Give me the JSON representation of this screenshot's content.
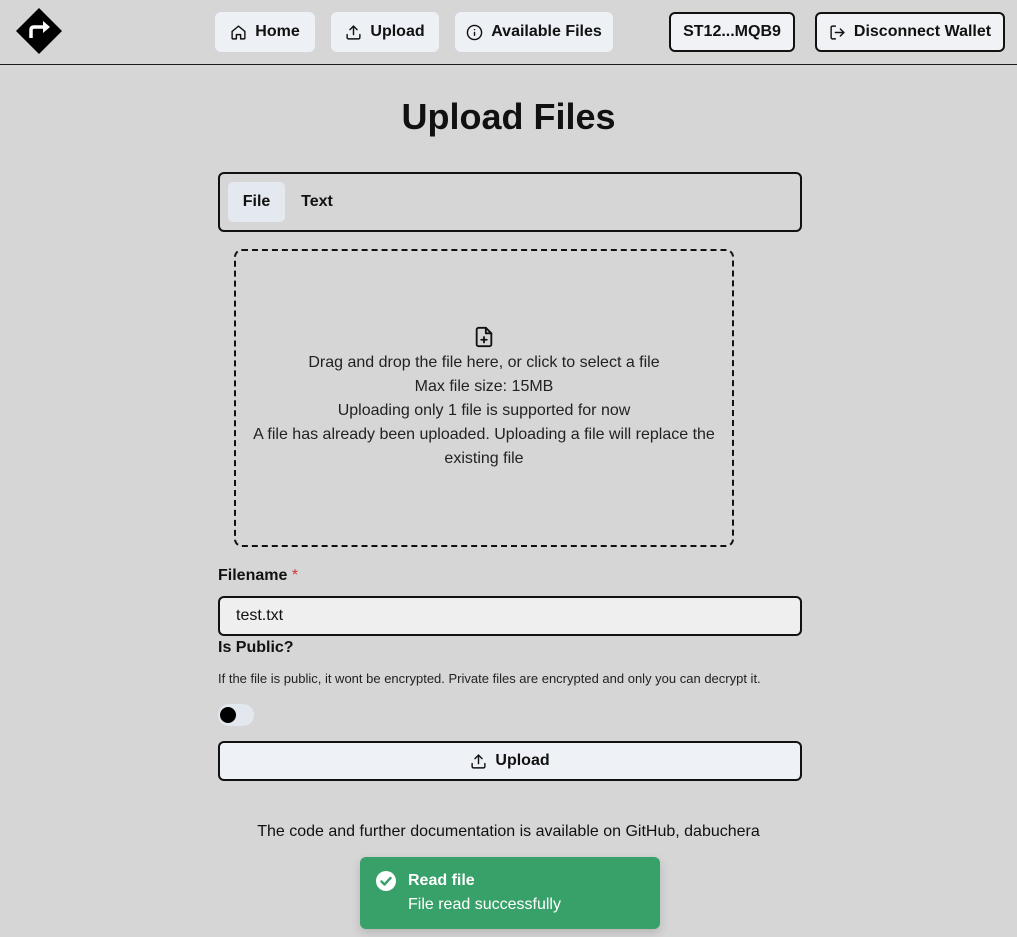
{
  "header": {
    "nav": {
      "home_label": "Home",
      "upload_label": "Upload",
      "available_files_label": "Available Files"
    },
    "wallet_address": "ST12...MQB9",
    "disconnect_label": "Disconnect Wallet"
  },
  "page_title": "Upload Files",
  "tabs": [
    {
      "label": "File",
      "active": true
    },
    {
      "label": "Text",
      "active": false
    }
  ],
  "dropzone": {
    "icon": "file-plus-icon",
    "line1": "Drag and drop the file here, or click to select a file",
    "line2": "Max file size: 15MB",
    "line3": "Uploading only 1 file is supported for now",
    "line4": "A file has already been uploaded. Uploading a file will replace the existing file"
  },
  "form": {
    "filename_label": "Filename",
    "required_mark": "*",
    "filename_value": "test.txt",
    "is_public_label": "Is Public?",
    "is_public_help": "If the file is public, it wont be encrypted. Private files are encrypted and only you can decrypt it.",
    "is_public_value": false,
    "upload_button_label": "Upload"
  },
  "footer": {
    "text": "The code and further documentation is available on GitHub, dabuchera"
  },
  "toast": {
    "icon": "check-circle-icon",
    "title": "Read file",
    "description": "File read successfully",
    "color": "#38a169"
  }
}
